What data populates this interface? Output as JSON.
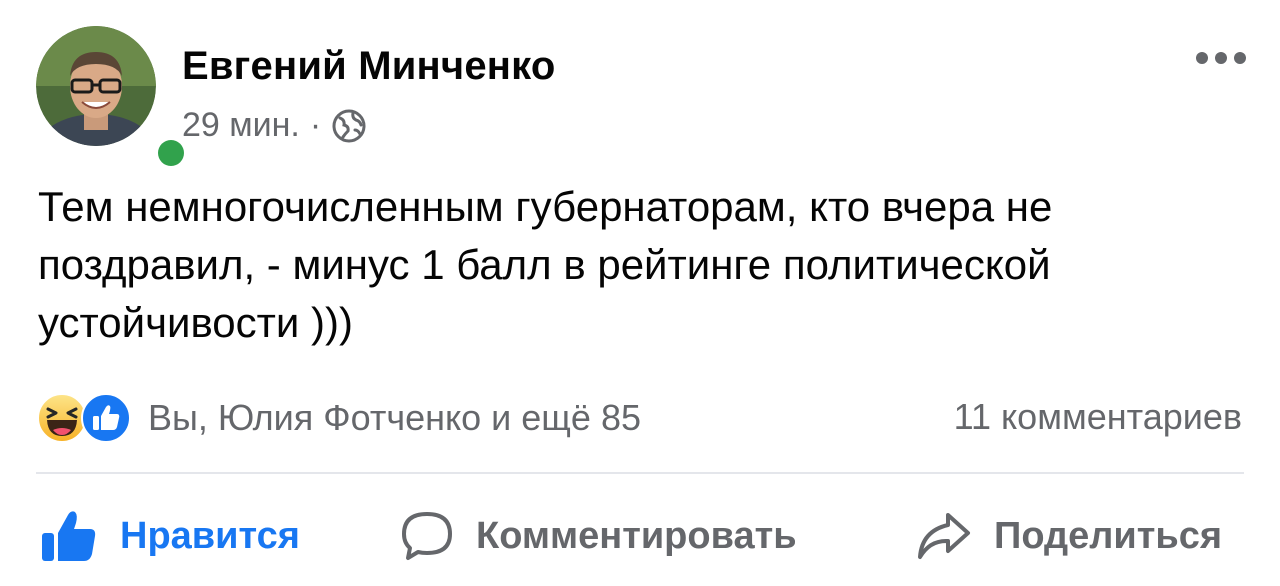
{
  "post": {
    "author": "Евгений Минченко",
    "time": "29 мин.",
    "separator": "·",
    "privacy_icon": "globe-icon",
    "online_status_color": "#31a24c",
    "text": "Тем немногочисленным губернаторам, кто вчера не\nпоздравил, - минус 1 балл в рейтинге политической\nустойчивости )))"
  },
  "reactions": {
    "icons": [
      "haha-icon",
      "like-icon"
    ],
    "summary": "Вы, Юлия Фотченко и ещё 85",
    "comments": "11 комментариев"
  },
  "actions": {
    "like": "Нравится",
    "comment": "Комментировать",
    "share": "Поделиться"
  },
  "colors": {
    "accent": "#1877f2",
    "secondary_text": "#65676b",
    "divider": "#e4e6eb"
  }
}
